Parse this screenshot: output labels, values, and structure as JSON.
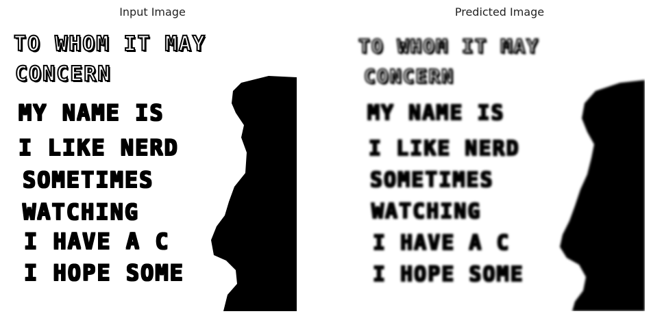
{
  "titles": {
    "left": "Input Image",
    "right": "Predicted Image"
  },
  "left_text": {
    "line1": "TO WHOM IT MAY",
    "line2": "CONCERN",
    "line3": "MY NAME IS",
    "line4": "I LIKE NERD",
    "line5": "SOMETIMES",
    "line6": "WATCHING",
    "line7": "I HAVE A C",
    "line8": "I HOPE SOME"
  },
  "right_text": {
    "line1": "TO WHOM IT MAY",
    "line2": "CONCERN",
    "line3": "MY NAME IS",
    "line4": "I LIKE NERD",
    "line5": "SOMETIMES",
    "line6": "WATCHING",
    "line7": "I HAVE A C",
    "line8": "I HOPE SOME"
  }
}
